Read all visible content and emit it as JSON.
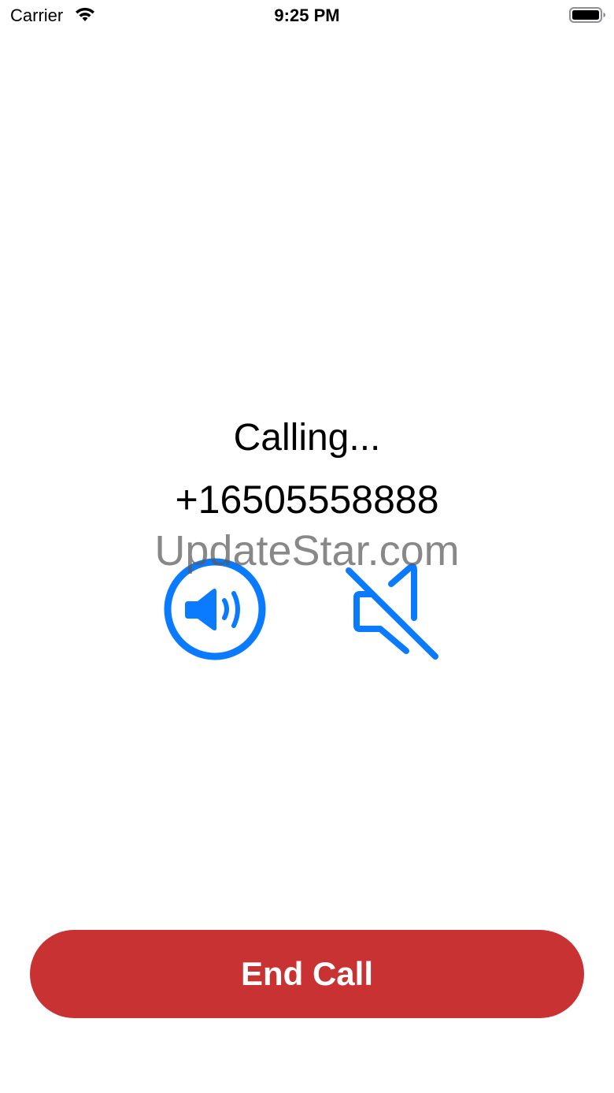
{
  "status_bar": {
    "carrier": "Carrier",
    "time": "9:25 PM",
    "wifi_icon": "wifi-icon",
    "battery_icon": "battery-full-icon"
  },
  "call": {
    "status": "Calling...",
    "number": "+16505558888"
  },
  "watermark": "UpdateStar.com",
  "controls": {
    "speaker_icon": "speaker-wave-circle-icon",
    "mute_icon": "speaker-slash-icon",
    "accent_color": "#0a7aff"
  },
  "end_call": {
    "label": "End Call",
    "color": "#c93233"
  }
}
